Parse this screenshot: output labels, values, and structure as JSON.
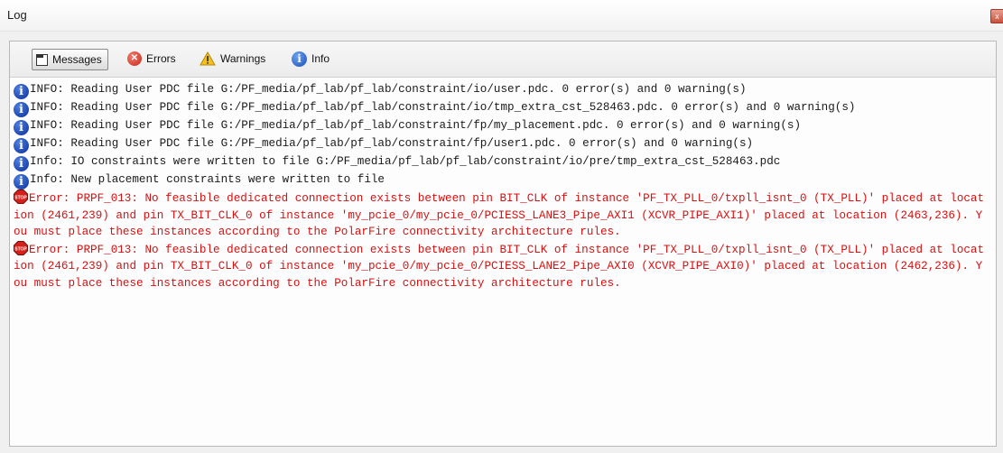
{
  "window": {
    "title": "Log",
    "close_glyph": "x"
  },
  "toolbar": {
    "messages_label": "Messages",
    "errors_label": "Errors",
    "warnings_label": "Warnings",
    "info_label": "Info"
  },
  "icons": {
    "messages": "list-icon",
    "errors": "error-icon",
    "warnings": "warning-icon",
    "info": "info-icon",
    "stop": "stop-icon"
  },
  "colors": {
    "error_text": "#d81010",
    "info_icon": "#0b2f9a"
  },
  "log": {
    "lines": [
      {
        "type": "info",
        "text": "INFO: Reading User PDC file G:/PF_media/pf_lab/pf_lab/constraint/io/user.pdc. 0 error(s) and 0 warning(s)"
      },
      {
        "type": "info",
        "text": "INFO: Reading User PDC file G:/PF_media/pf_lab/pf_lab/constraint/io/tmp_extra_cst_528463.pdc. 0 error(s) and 0 warning(s)"
      },
      {
        "type": "info",
        "text": "INFO: Reading User PDC file G:/PF_media/pf_lab/pf_lab/constraint/fp/my_placement.pdc. 0 error(s) and 0 warning(s)"
      },
      {
        "type": "info",
        "text": "INFO: Reading User PDC file G:/PF_media/pf_lab/pf_lab/constraint/fp/user1.pdc. 0 error(s) and 0 warning(s)"
      },
      {
        "type": "info",
        "text": "Info: IO constraints were written to file G:/PF_media/pf_lab/pf_lab/constraint/io/pre/tmp_extra_cst_528463.pdc"
      },
      {
        "type": "info",
        "text": "Info: New placement constraints were written to file"
      },
      {
        "type": "error",
        "text": "Error: PRPF_013: No feasible dedicated connection exists between pin BIT_CLK of instance 'PF_TX_PLL_0/txpll_isnt_0 (TX_PLL)' placed at location (2461,239) and pin TX_BIT_CLK_0 of instance 'my_pcie_0/my_pcie_0/PCIESS_LANE3_Pipe_AXI1 (XCVR_PIPE_AXI1)' placed at location (2463,236). You must place these instances according to the PolarFire connectivity architecture rules."
      },
      {
        "type": "error",
        "text": "Error: PRPF_013: No feasible dedicated connection exists between pin BIT_CLK of instance 'PF_TX_PLL_0/txpll_isnt_0 (TX_PLL)' placed at location (2461,239) and pin TX_BIT_CLK_0 of instance 'my_pcie_0/my_pcie_0/PCIESS_LANE2_Pipe_AXI0 (XCVR_PIPE_AXI0)' placed at location (2462,236). You must place these instances according to the PolarFire connectivity architecture rules."
      }
    ]
  }
}
